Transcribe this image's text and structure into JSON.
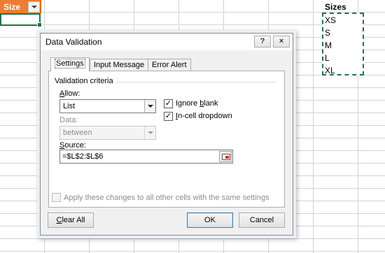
{
  "sheet": {
    "header_cell": "Size",
    "sizes_header": "Sizes",
    "sizes": [
      "XS",
      "S",
      "M",
      "L",
      "XL"
    ]
  },
  "dialog": {
    "title": "Data Validation",
    "help_glyph": "?",
    "close_glyph": "×",
    "tabs": [
      "Settings",
      "Input Message",
      "Error Alert"
    ],
    "active_tab": "Settings",
    "section_title": "Validation criteria",
    "allow": {
      "label_u": "A",
      "label_rest": "llow:",
      "value": "List"
    },
    "ignore_blank": {
      "label_pre": "Ignore ",
      "label_u": "b",
      "label_rest": "lank",
      "checked": true
    },
    "in_cell_dropdown": {
      "label_pre": "",
      "label_u": "I",
      "label_rest": "n-cell dropdown",
      "checked": true
    },
    "data": {
      "label": "Data:",
      "value": "between"
    },
    "source": {
      "label_u": "S",
      "label_rest": "ource:",
      "value": "=$L$2:$L$6"
    },
    "apply_all": {
      "label": "Apply these changes to all other cells with the same settings",
      "checked": false
    },
    "buttons": {
      "clear_u": "C",
      "clear_rest": "lear All",
      "ok": "OK",
      "cancel": "Cancel"
    },
    "check_glyph": "✓"
  }
}
